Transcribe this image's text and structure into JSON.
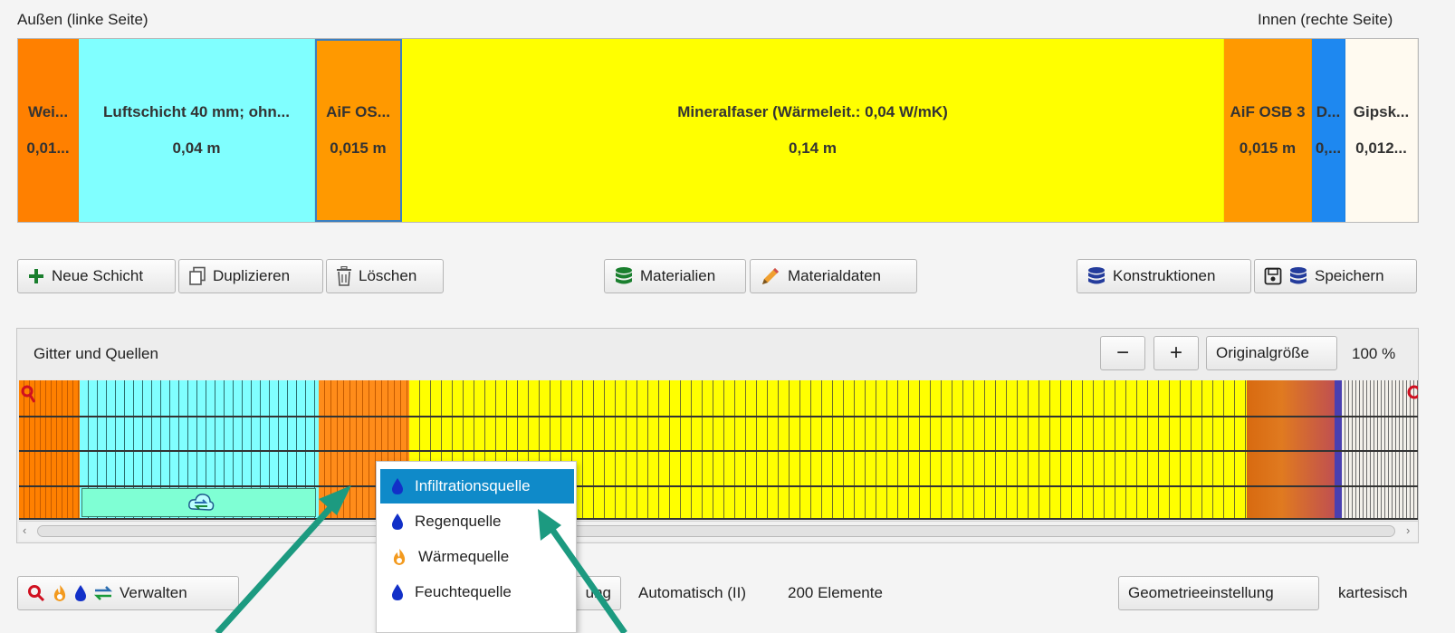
{
  "header": {
    "outside_label": "Außen (linke Seite)",
    "inside_label": "Innen (rechte Seite)"
  },
  "layers": [
    {
      "name": "Wei...",
      "thickness": "0,01...",
      "color": "#ff8000"
    },
    {
      "name": "Luftschicht 40 mm; ohn...",
      "thickness": "0,04 m",
      "color": "#80ffff"
    },
    {
      "name": "AiF OS...",
      "thickness": "0,015 m",
      "color": "#ff9900",
      "selected": true
    },
    {
      "name": "Mineralfaser (Wärmeleit.: 0,04 W/mK)",
      "thickness": "0,14 m",
      "color": "#ffff00"
    },
    {
      "name": "AiF OSB 3",
      "thickness": "0,015 m",
      "color": "#ff9900"
    },
    {
      "name": "D...",
      "thickness": "0,...",
      "color": "#1e88f0"
    },
    {
      "name": "Gipsk...",
      "thickness": "0,012...",
      "color": "#fffaf0"
    }
  ],
  "toolbar": {
    "new_layer": "Neue Schicht",
    "duplicate": "Duplizieren",
    "delete": "Löschen",
    "materials": "Materialien",
    "material_data": "Materialdaten",
    "constructions": "Konstruktionen",
    "save": "Speichern"
  },
  "grid_panel": {
    "title": "Gitter und Quellen",
    "zoom_out": "−",
    "zoom_in": "+",
    "original_size": "Originalgröße",
    "zoom_level": "100 %"
  },
  "context_menu": {
    "items": [
      {
        "label": "Infiltrationsquelle",
        "icon": "water-drop-icon",
        "active": true
      },
      {
        "label": "Regenquelle",
        "icon": "water-drop-icon"
      },
      {
        "label": "Wärmequelle",
        "icon": "flame-icon"
      },
      {
        "label": "Feuchtequelle",
        "icon": "water-drop-icon"
      }
    ]
  },
  "bottom": {
    "manage": "Verwalten",
    "partial_button": "ung",
    "mode": "Automatisch (II)",
    "elements": "200 Elemente",
    "geometry_settings": "Geometrieeinstellung",
    "geometry_type": "kartesisch"
  },
  "colors": {
    "accent_arrow": "#1c9a80",
    "menu_highlight": "#0f8ac9"
  }
}
